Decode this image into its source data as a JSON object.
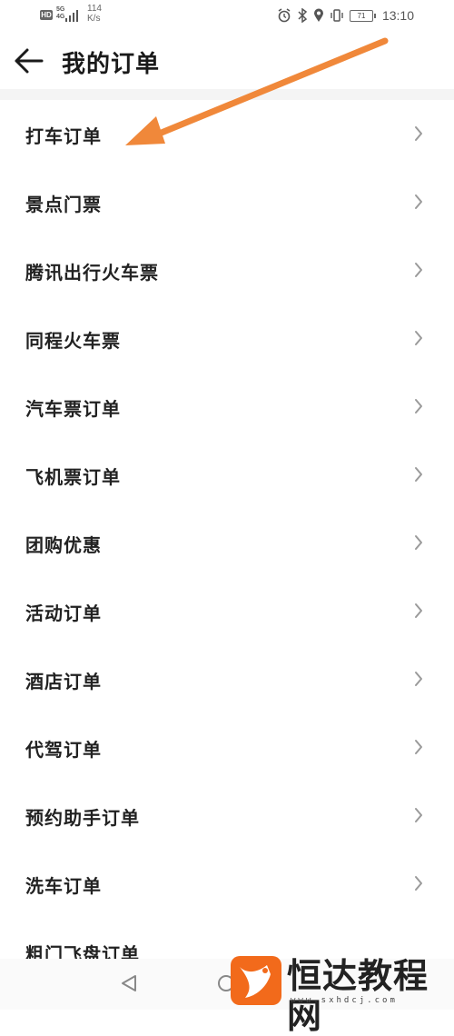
{
  "status_bar": {
    "hd": "HD",
    "network_top": "5G",
    "network_bottom": "4G",
    "speed_value": "114",
    "speed_unit": "K/s",
    "battery": "71",
    "time": "13:10"
  },
  "header": {
    "title": "我的订单"
  },
  "orders": [
    {
      "label": "打车订单"
    },
    {
      "label": "景点门票"
    },
    {
      "label": "腾讯出行火车票"
    },
    {
      "label": "同程火车票"
    },
    {
      "label": "汽车票订单"
    },
    {
      "label": "飞机票订单"
    },
    {
      "label": "团购优惠"
    },
    {
      "label": "活动订单"
    },
    {
      "label": "酒店订单"
    },
    {
      "label": "代驾订单"
    },
    {
      "label": "预约助手订单"
    },
    {
      "label": "洗车订单"
    },
    {
      "label": "粗门飞盘订单"
    }
  ],
  "watermark": {
    "text": "恒达教程网",
    "url": "www.sxhdcj.com"
  },
  "colors": {
    "annotation_arrow": "#f0883a",
    "watermark_logo": "#f26a1b",
    "text": "#222222",
    "chevron": "#9a9a9a"
  }
}
